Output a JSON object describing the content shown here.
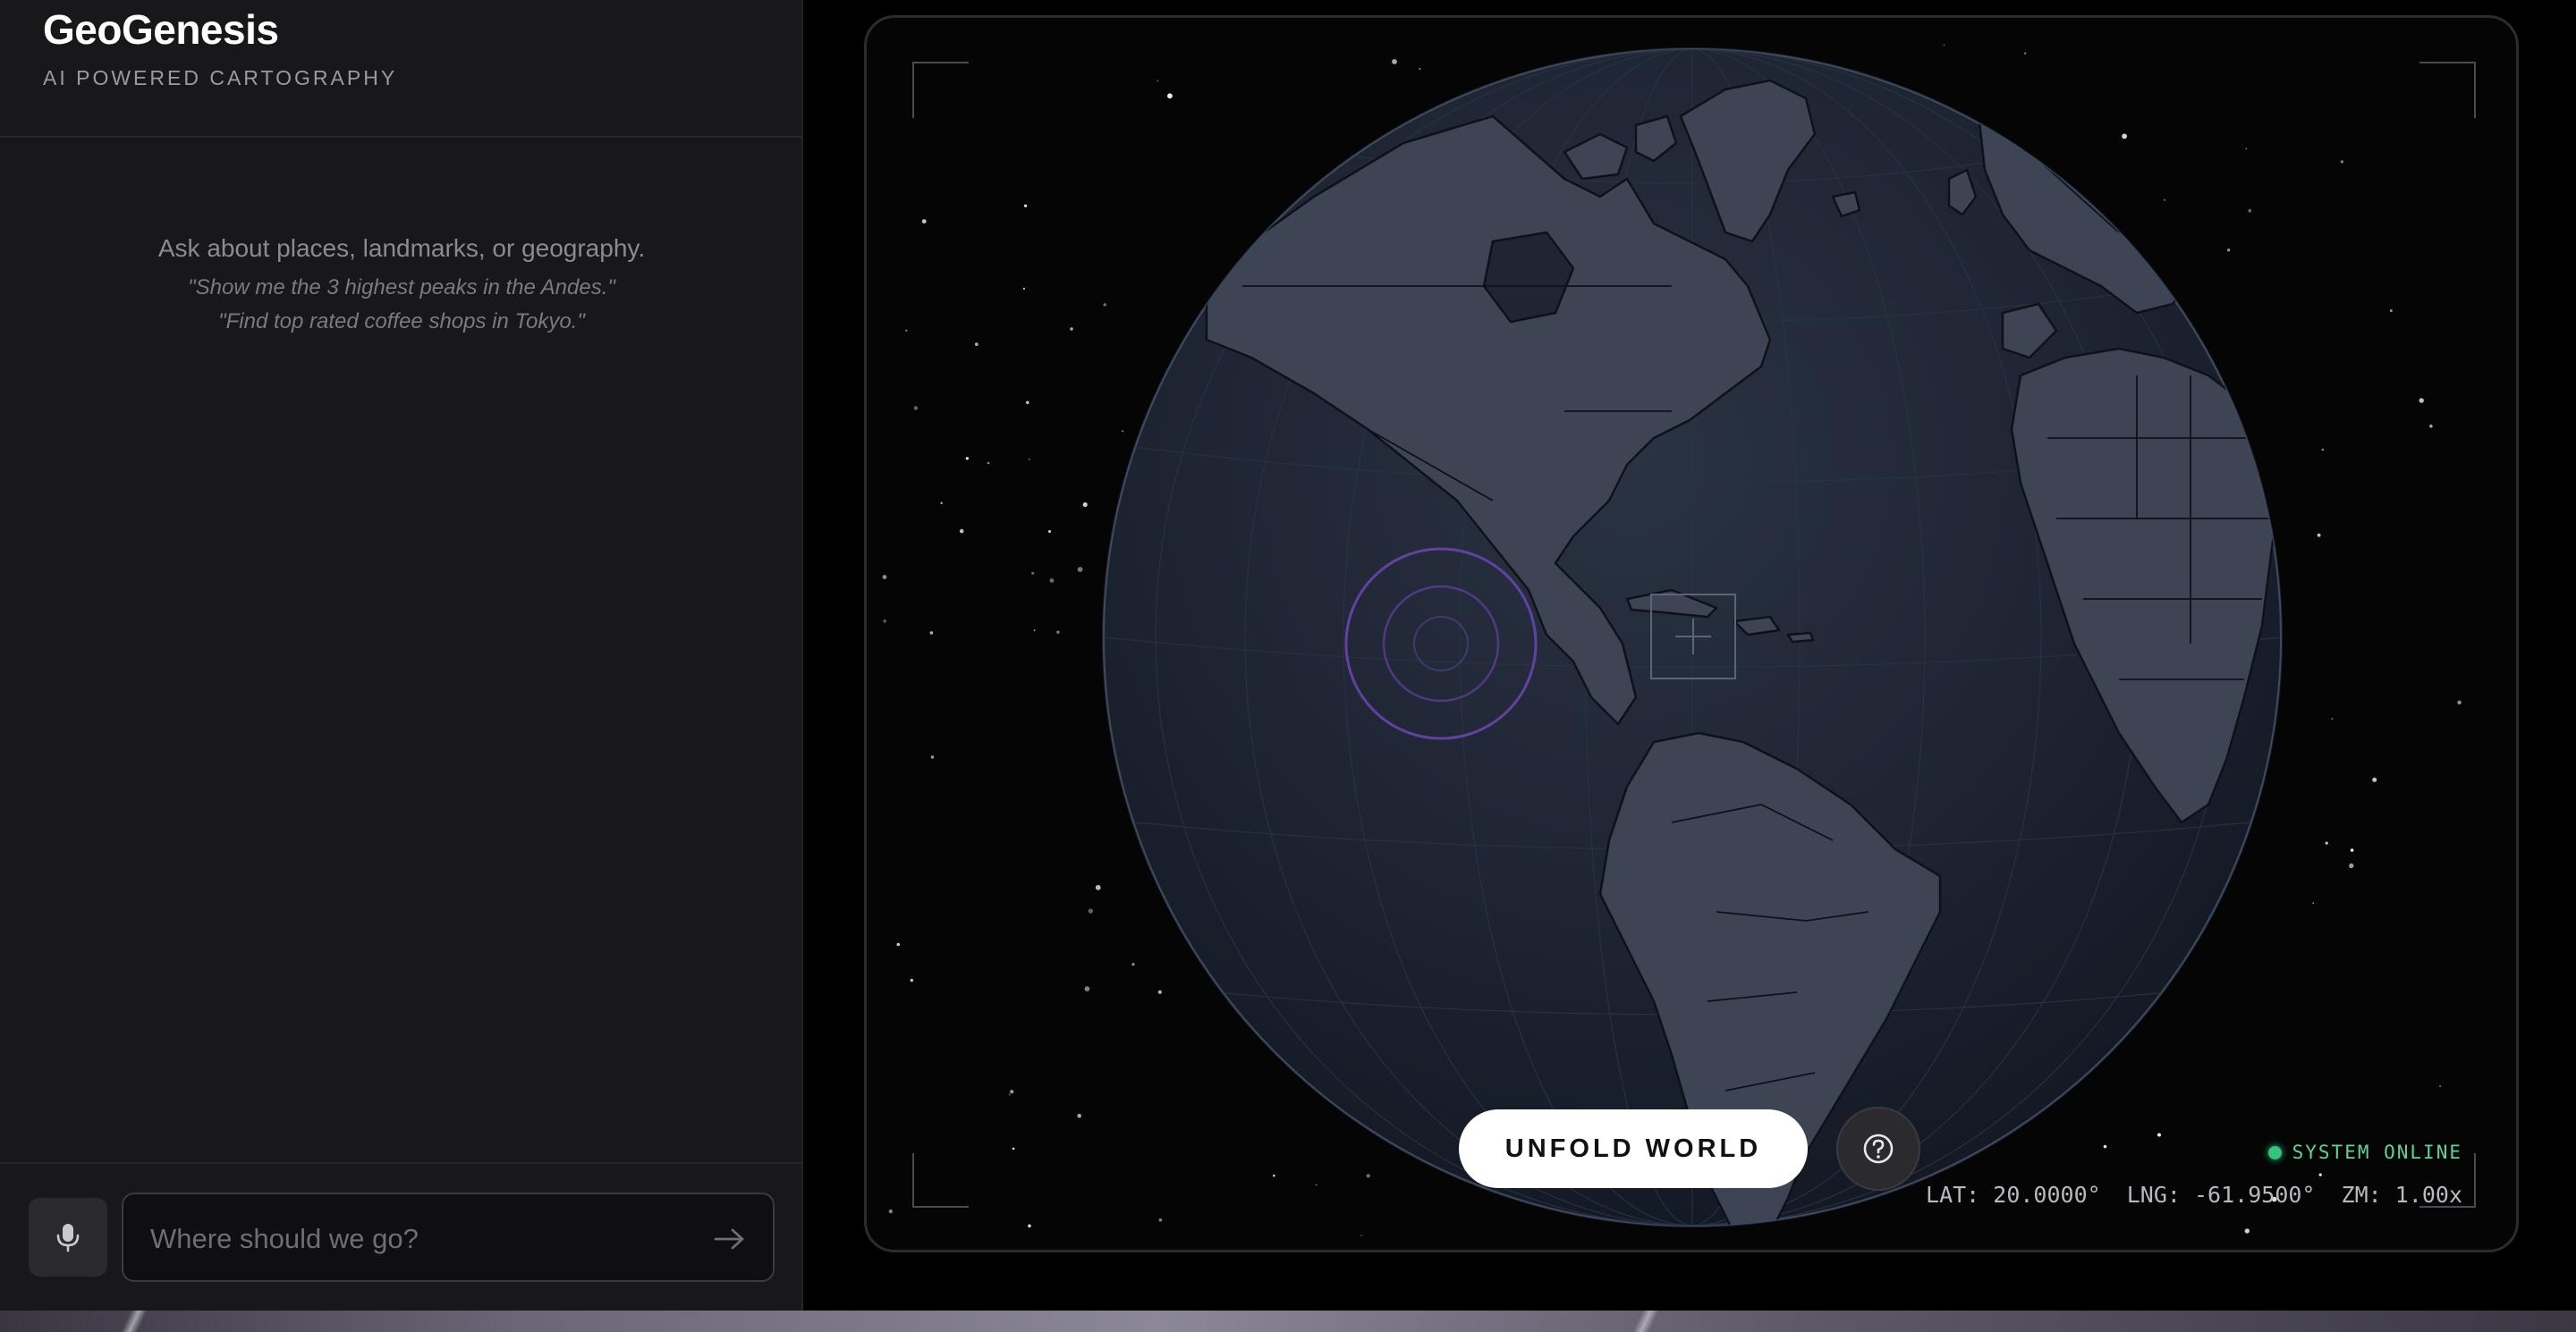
{
  "app": {
    "title": "GeoGenesis",
    "subtitle": "AI POWERED CARTOGRAPHY"
  },
  "chat": {
    "empty_hint": "Ask about places, landmarks, or geography.",
    "examples": [
      "\"Show me the 3 highest peaks in the Andes.\"",
      "\"Find top rated coffee shops in Tokyo.\""
    ]
  },
  "composer": {
    "placeholder": "Where should we go?",
    "value": "",
    "mic_icon": "microphone-icon",
    "send_icon": "arrow-right-icon"
  },
  "map": {
    "status": "SYSTEM ONLINE",
    "coords": {
      "lat": "LAT: 20.0000°",
      "lng": "LNG: -61.9500°",
      "zoom": "ZM: 1.00x"
    },
    "unfold_label": "UNFOLD WORLD",
    "help_icon": "help-circle-icon",
    "colors": {
      "ocean": "#1c2431",
      "land": "#3d4555",
      "land_stroke": "#0e1118",
      "marker": "#7c4dc2",
      "status": "#34c57c"
    }
  }
}
